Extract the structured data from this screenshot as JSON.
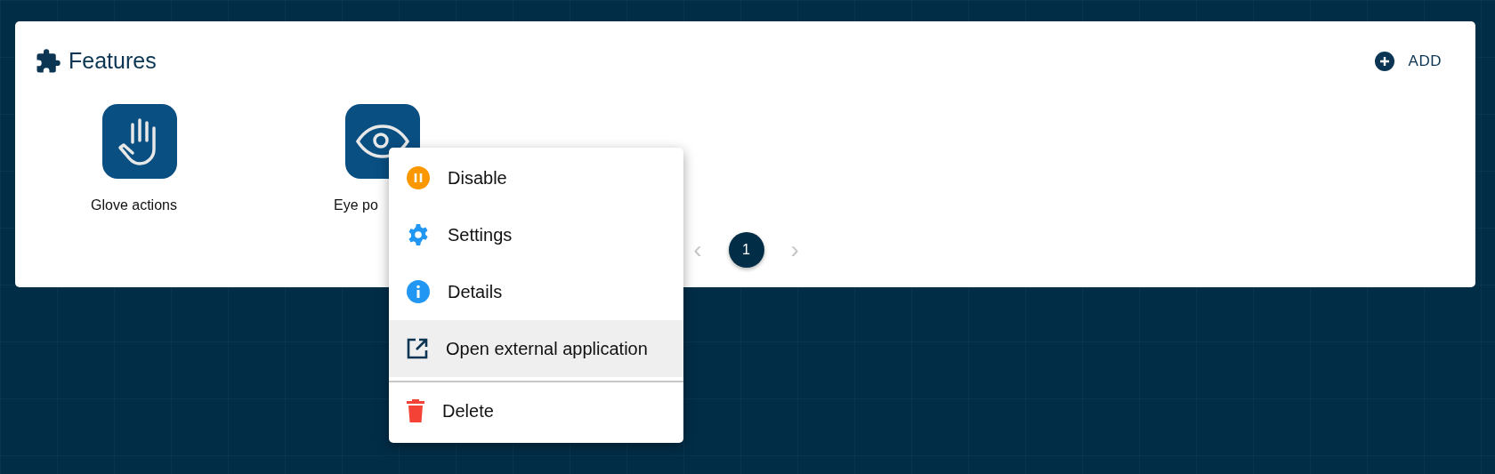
{
  "panel": {
    "title": "Features",
    "add_button": "ADD"
  },
  "features": [
    {
      "label": "Glove actions",
      "kind": "hand"
    },
    {
      "label": "Eye po",
      "kind": "eye"
    }
  ],
  "pagination": {
    "prev": {
      "label": "‹",
      "disabled": true
    },
    "pages": [
      {
        "label": "1",
        "selected": true
      }
    ],
    "next": {
      "label": "›",
      "disabled": true
    }
  },
  "context_menu": [
    {
      "label": "Disable",
      "kind": "pause",
      "color": "#fb9800",
      "selected": false,
      "divider_before": false
    },
    {
      "label": "Settings",
      "kind": "gear",
      "color": "#2196f3",
      "selected": false,
      "divider_before": false
    },
    {
      "label": "Details",
      "kind": "info",
      "color": "#2196f3",
      "selected": false,
      "divider_before": false
    },
    {
      "label": "Open external application",
      "kind": "external",
      "color": "#0b3553",
      "selected": true,
      "divider_before": false
    },
    {
      "label": "Delete",
      "kind": "trash",
      "color": "#f44336",
      "selected": false,
      "divider_before": true
    }
  ]
}
